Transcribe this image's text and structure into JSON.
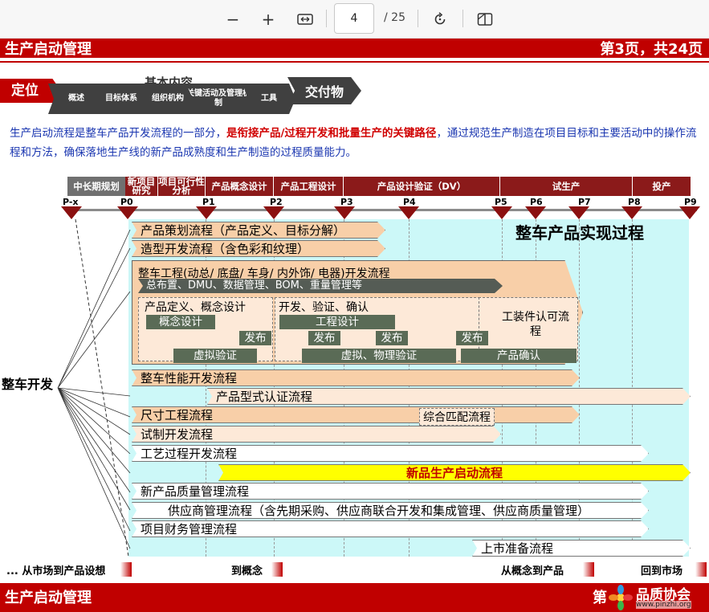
{
  "toolbar": {
    "zoom_out": "−",
    "zoom_in": "+",
    "page_current": "4",
    "page_total": "/ 25",
    "icons": [
      "zoom-out-icon",
      "zoom-in-icon",
      "fit-width-icon",
      "rotate-icon",
      "two-page-icon"
    ]
  },
  "slide": {
    "header_title": "生产启动管理",
    "header_page": "第3页，共24页",
    "position_tag": "定位",
    "nav_heading": "基本内容",
    "nav_items": [
      "概述",
      "目标体系",
      "组织机构",
      "关键活动及管理机制",
      "工具"
    ],
    "deliverable": "交付物",
    "intro": {
      "part1": "生产启动流程是整车产品开发流程的一部分，",
      "highlight": "是衔接产品/过程开发和批量生产的关键路径",
      "part2": "，通过规范生产制造在项目目标和主要活动中的操作流程和方法，确保落地生产线的新产品成熟度和生产制造的过程质量能力。"
    },
    "phases": [
      {
        "label": "中长期规划",
        "color": "#707070"
      },
      {
        "label": "新项目研究",
        "color": "#8b1a1a"
      },
      {
        "label": "项目可行性分析",
        "color": "#8b1a1a"
      },
      {
        "label": "产品概念设计",
        "color": "#8b1a1a"
      },
      {
        "label": "产品工程设计",
        "color": "#8b1a1a"
      },
      {
        "label": "产品设计验证（DV）",
        "color": "#8b1a1a"
      },
      {
        "label": "试生产",
        "color": "#8b1a1a"
      },
      {
        "label": "投产",
        "color": "#8b1a1a"
      }
    ],
    "milestones": [
      "P-x",
      "P0",
      "P1",
      "P2",
      "P3",
      "P4",
      "P5",
      "P6",
      "P7",
      "P8",
      "P9"
    ],
    "section_title": "整车产品实现过程",
    "side_label": "整车开发",
    "flows": {
      "product_planning": "产品策划流程（产品定义、目标分解）",
      "styling": "造型开发流程（含色彩和纹理）",
      "vehicle_engineering": "整车工程(动总/ 底盘/ 车身/ 内外饰/ 电器)开发流程",
      "layout_mgmt": "总布置、DMU、数据管理、BOM、重量管理等",
      "concept_box": "产品定义、概念设计",
      "concept_design": "概念设计",
      "release": "发布",
      "dev_box": "开发、验证、确认",
      "engineering_design": "工程设计",
      "tooling_box": "工装件认可流程",
      "virtual_validation": "虚拟验证",
      "virtual_physical": "虚拟、物理验证",
      "product_confirm": "产品确认",
      "performance": "整车性能开发流程",
      "type_approval": "产品型式认证流程",
      "dimension": "尺寸工程流程",
      "integrated_matching": "综合匹配流程",
      "prototype": "试制开发流程",
      "process": "工艺过程开发流程",
      "production_launch": "新品生产启动流程",
      "quality": "新产品质量管理流程",
      "supplier": "供应商管理流程（含先期采购、供应商联合开发和集成管理、供应商质量管理）",
      "finance": "项目财务管理流程",
      "market_prep": "上市准备流程"
    },
    "bottom_phases": [
      "... 从市场到产品设想",
      "到概念",
      "从概念到产品",
      "回到市场"
    ],
    "footer_title": "生产启动管理",
    "footer_page": "第",
    "watermark": {
      "t1": "品质协会",
      "t2": "www.pinzhi.org"
    }
  }
}
